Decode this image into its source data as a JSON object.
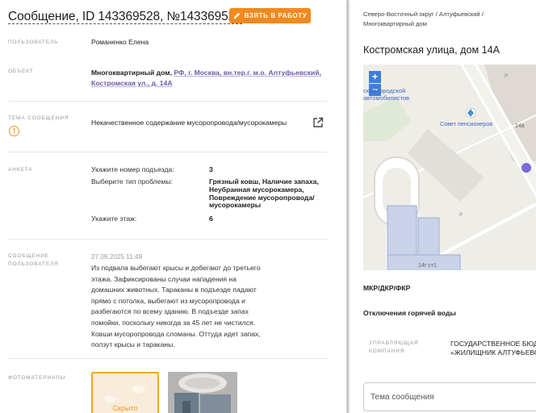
{
  "header": {
    "title": "Сообщение, ID 143369528, №143369528",
    "take_button": "ВЗЯТЬ В РАБОТУ"
  },
  "fields": {
    "user_label": "ПОЛЬЗОВАТЕЛЬ",
    "user_value": "Романенко Елена",
    "object_label": "ОБЪЕКТ",
    "object_prefix": "Многоквартирный дом,",
    "object_address": "РФ, г. Москва, вн.тер.г. м.о. Алтуфьевский, Костромская ул., д. 14А",
    "topic_label": "ТЕМА СООБЩЕНИЯ",
    "topic_value": "Некачественное содержание мусоропровода/мусорокамеры",
    "survey_label": "АНКЕТА",
    "message_label_1": "СООБЩЕНИЕ",
    "message_label_2": "ПОЛЬЗОВАТЕЛЯ",
    "photos_label": "ФОТОМАТЕРИАЛЫ"
  },
  "survey": [
    {
      "q": "Укажите номер подъезда:",
      "a": "3"
    },
    {
      "q": "Выберите тип проблемы:",
      "a": "Грязный ковш, Наличие запаха, Неубранная мусорокамера, Повреждение мусоропровода/мусорокамеры"
    },
    {
      "q": "Укажите этаж:",
      "a": "6"
    }
  ],
  "message": {
    "date": "27.09.2025 11:49",
    "text": "Из подвала выбегают крысы и добегают до третьего этажа. Зафиксированы случаи нападения на домашних животных. Тараканы в подъезде падают прямо с потолка, выбегают из мусоропровода и разбегаются по всему зданию. В подъезде запах помойки, поскольку никогда за 45 лет не чистился. Ковши мусоропровода сломаны. Оттуда идет запах, ползут крысы и тараканы."
  },
  "photos": {
    "hidden_label": "Скрыто"
  },
  "right": {
    "breadcrumb": "Северо-Восточный округ / Алтуфьевский / Многоквартирный дом",
    "address_title": "Костромская улица, дом 14А",
    "map": {
      "zoom_in": "+",
      "zoom_out": "−",
      "label_society": "ской городской",
      "label_society_2": "автомобилистов",
      "label_council": "Совет пенсионеров",
      "label_14a": "14а",
      "label_14g": "14г ст1",
      "label_p1": "P",
      "label_p2": "P"
    },
    "mkr": "МКР/ДКР/ФКР",
    "hot_water": "Отключения горячей воды",
    "mgmt_label_1": "УПРАВЛЯЮЩАЯ",
    "mgmt_label_2": "КОМПАНИЯ",
    "mgmt_value_1": "ГОСУДАРСТВЕННОЕ БЮД",
    "mgmt_value_2": "«ЖИЛИЩНИК АЛТУФЬЕВС",
    "subject_placeholder": "Тема сообщения"
  },
  "colors": {
    "accent": "#f2891e",
    "link": "#6e5aa6",
    "map_button": "#3f7fd8",
    "marker": "#7b6cd6"
  }
}
